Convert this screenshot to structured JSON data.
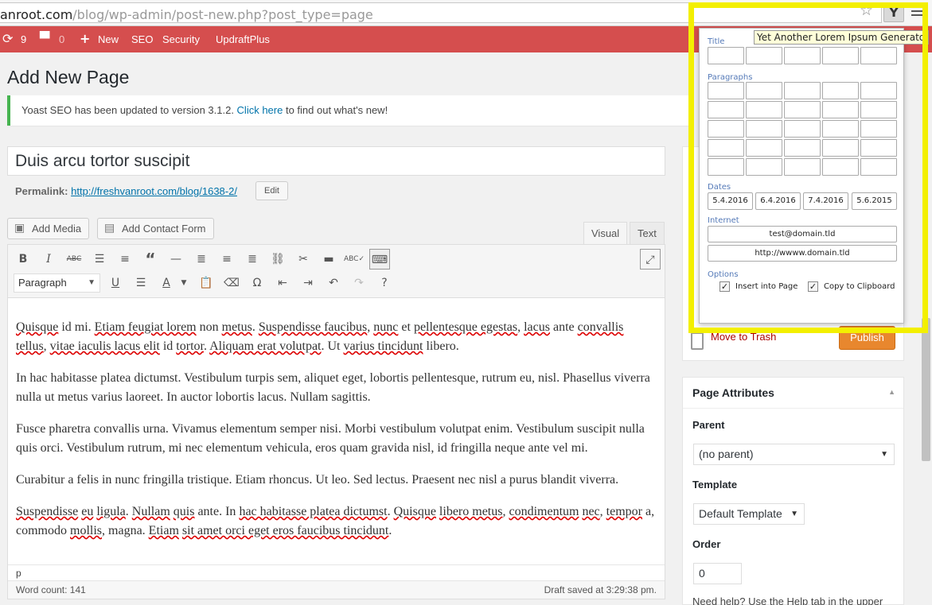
{
  "browser": {
    "url_host": "anroot.com",
    "url_path": "/blog/wp-admin/post-new.php?post_type=page",
    "extension_label": "Y",
    "tooltip": "Yet Another Lorem Ipsum Generator"
  },
  "adminbar": {
    "updates_count": "9",
    "comments_count": "0",
    "new_label": "New",
    "seo_label": "SEO",
    "security_label": "Security",
    "updraft_label": "UpdraftPlus"
  },
  "page": {
    "title": "Add New Page",
    "notice_prefix": "Yoast SEO has been updated to version 3.1.2. ",
    "notice_link": "Click here",
    "notice_suffix": " to find out what's new!",
    "post_title": "Duis arcu tortor suscipit",
    "permalink_label": "Permalink:",
    "permalink_url": "http://freshvanroot.com/blog/1638-2/",
    "edit_button": "Edit"
  },
  "editor": {
    "add_media": "Add Media",
    "add_contact_form": "Add Contact Form",
    "tab_visual": "Visual",
    "tab_text": "Text",
    "format_select": "Paragraph",
    "paragraphs": [
      "Quisque id mi. Etiam feugiat lorem non metus. Suspendisse faucibus, nunc et pellentesque egestas, lacus ante convallis tellus, vitae iaculis lacus elit id tortor. Aliquam erat volutpat. Ut varius tincidunt libero.",
      "In hac habitasse platea dictumst. Vestibulum turpis sem, aliquet eget, lobortis pellentesque, rutrum eu, nisl. Phasellus viverra nulla ut metus varius laoreet. In auctor lobortis lacus. Nullam sagittis.",
      "Fusce pharetra convallis urna. Vivamus elementum semper nisi. Morbi vestibulum volutpat enim. Vestibulum suscipit nulla quis orci. Vestibulum rutrum, mi nec elementum vehicula, eros quam gravida nisl, id fringilla neque ante vel mi.",
      "Curabitur a felis in nunc fringilla tristique. Etiam rhoncus. Ut leo. Sed lectus. Praesent nec nisl a purus blandit viverra.",
      "Suspendisse eu ligula. Nullam quis ante. In hac habitasse platea dictumst. Quisque libero metus, condimentum nec, tempor a, commodo mollis, magna. Etiam sit amet orci eget eros faucibus tincidunt."
    ],
    "path": "p",
    "word_count": "Word count: 141",
    "draft_saved": "Draft saved at 3:29:38 pm."
  },
  "sidebar": {
    "move_to_trash": "Move to Trash",
    "publish": "Publish",
    "attributes_title": "Page Attributes",
    "parent_label": "Parent",
    "parent_value": "(no parent)",
    "template_label": "Template",
    "template_value": "Default Template",
    "order_label": "Order",
    "order_value": "0",
    "help_text": "Need help? Use the Help tab in the upper"
  },
  "popup": {
    "title_label": "Title",
    "paragraphs_label": "Paragraphs",
    "dates_label": "Dates",
    "dates": [
      "5.4.2016",
      "6.4.2016",
      "7.4.2016",
      "5.6.2015"
    ],
    "internet_label": "Internet",
    "email": "test@domain.tld",
    "url": "http://wwww.domain.tld",
    "options_label": "Options",
    "insert_label": "Insert into Page",
    "copy_label": "Copy to Clipboard",
    "insert_checked": true,
    "copy_checked": true
  },
  "colors": {
    "adminbar": "#d54e4e",
    "highlight": "#f3ef00",
    "link": "#0073aa",
    "publish": "#e8872e"
  }
}
